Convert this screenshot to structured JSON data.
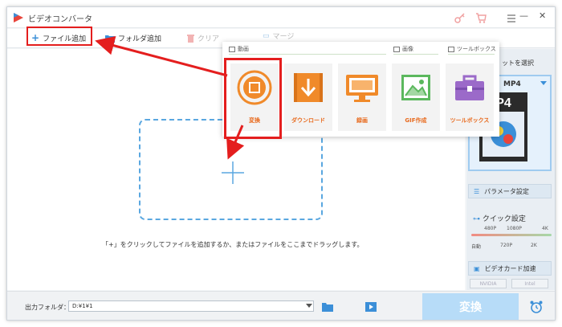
{
  "app": {
    "title": "ビデオコンバータ"
  },
  "toolbar": {
    "add_file": "ファイル追加",
    "add_folder": "フォルダ追加",
    "clear": "クリア",
    "merge": "マージ"
  },
  "workspace": {
    "hint": "「+」をクリックしてファイルを追加するか、またはファイルをここまでドラッグします。"
  },
  "popup": {
    "categories": {
      "video": "動画",
      "image": "画像",
      "toolbox": "ツールボックス"
    },
    "tiles": [
      {
        "label": "変換",
        "icon": "film-reel-icon"
      },
      {
        "label": "ダウンロード",
        "icon": "download-icon"
      },
      {
        "label": "録画",
        "icon": "screen-record-icon"
      },
      {
        "label": "GIF作成",
        "icon": "image-icon"
      },
      {
        "label": "ツールボックス",
        "icon": "toolbox-icon"
      }
    ]
  },
  "right_panel": {
    "format_select_label": "ットを選択",
    "format": "MP4",
    "mp4_art_text": "P4",
    "parameter_settings": "パラメータ設定",
    "quick_settings": "クイック設定",
    "quick_top": [
      "480P",
      "1080P",
      "4K"
    ],
    "quick_bottom": [
      "自動",
      "720P",
      "2K"
    ],
    "gpu_acceleration": "ビデオカード加速",
    "gpu_nvidia": "NVIDIA",
    "gpu_intel": "Intel"
  },
  "bottom": {
    "output_label": "出力フォルダ：",
    "output_path": "D:¥1¥1",
    "convert_button": "変換"
  },
  "colors": {
    "accent_orange": "#f08a2a",
    "accent_blue": "#3b8fd8",
    "highlight_red": "#e41e1e",
    "convert_disabled": "#b7dcf8"
  }
}
